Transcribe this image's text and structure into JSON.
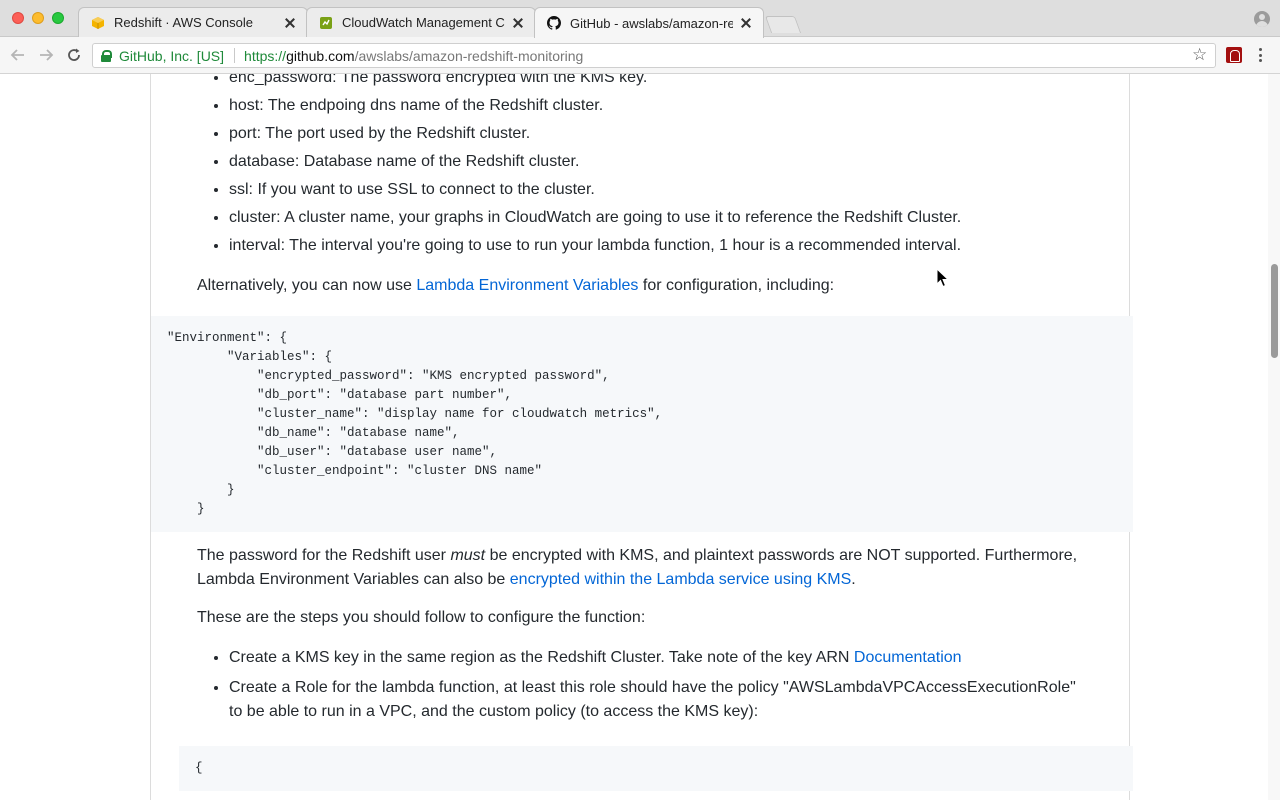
{
  "browser": {
    "tabs": [
      {
        "title": "Redshift · AWS Console",
        "icon": "aws-cube-icon",
        "icon_color": "#f4b400"
      },
      {
        "title": "CloudWatch Management Con",
        "icon": "cloudwatch-icon",
        "icon_color": "#7aa116"
      },
      {
        "title": "GitHub - awslabs/amazon-redsh",
        "icon": "github-octocat-icon",
        "icon_color": "#111111"
      }
    ],
    "active_tab": 2,
    "address": {
      "ev_name": "GitHub, Inc. [US]",
      "scheme": "https://",
      "host": "github.com",
      "path": "/awslabs/amazon-redshift-monitoring"
    }
  },
  "readme": {
    "config_items": [
      "enc_password: The password encrypted with the KMS key.",
      "host: The endpoing dns name of the Redshift cluster.",
      "port: The port used by the Redshift cluster.",
      "database: Database name of the Redshift cluster.",
      "ssl: If you want to use SSL to connect to the cluster.",
      "cluster: A cluster name, your graphs in CloudWatch are going to use it to reference the Redshift Cluster.",
      "interval: The interval you're going to use to run your lambda function, 1 hour is a recommended interval."
    ],
    "alt_para": {
      "before": "Alternatively, you can now use ",
      "link": "Lambda Environment Variables",
      "after": " for configuration, including:"
    },
    "env_code": "\"Environment\": {\n        \"Variables\": {\n            \"encrypted_password\": \"KMS encrypted password\",\n            \"db_port\": \"database part number\",\n            \"cluster_name\": \"display name for cloudwatch metrics\",\n            \"db_name\": \"database name\",\n            \"db_user\": \"database user name\",\n            \"cluster_endpoint\": \"cluster DNS name\"\n        }\n    }",
    "password_para": {
      "before": "The password for the Redshift user ",
      "em": "must",
      "middle": " be encrypted with KMS, and plaintext passwords are NOT supported. Furthermore, Lambda Environment Variables can also be ",
      "link": "encrypted within the Lambda service using KMS",
      "after": "."
    },
    "steps_intro": "These are the steps you should follow to configure the function:",
    "steps": [
      {
        "text": "Create a KMS key in the same region as the Redshift Cluster. Take note of the key ARN ",
        "link": "Documentation"
      },
      {
        "text": "Create a Role for the lambda function, at least this role should have the policy \"AWSLambdaVPCAccessExecutionRole\" to be able to run in a VPC, and the custom policy (to access the KMS key):",
        "link": ""
      }
    ],
    "policy_code_start": "{"
  }
}
